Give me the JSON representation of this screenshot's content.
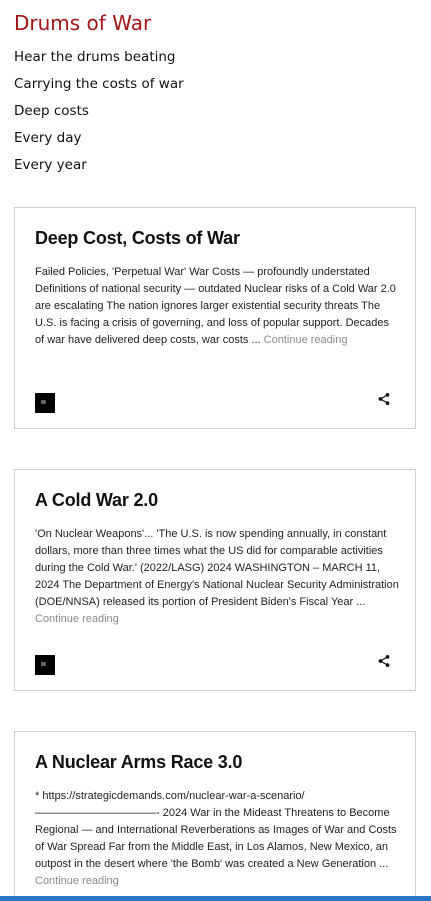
{
  "site": {
    "title": "Drums of War",
    "taglines": [
      "Hear the drums beating",
      "Carrying the costs of war",
      "Deep costs",
      "Every day",
      "Every year"
    ]
  },
  "posts": [
    {
      "title": "Deep Cost, Costs of War",
      "excerpt": "Failed Policies, 'Perpetual War'   War Costs — profoundly understated Definitions of national security — outdated Nuclear risks of a Cold War 2.0 are escalating The nation ignores larger existential security threats   The U.S. is facing a crisis of governing, and loss of popular support. Decades of war have delivered deep costs, war costs ...",
      "continue": "Continue reading"
    },
    {
      "title": "A Cold War 2.0",
      "excerpt": "    'On Nuclear Weapons'... 'The U.S. is now spending annually, in constant dollars, more than three times what the US did for comparable activities during the Cold War.' (2022/LASG)     2024 WASHINGTON – MARCH 11, 2024 The Department of Energy's National Nuclear Security Administration (DOE/NNSA) released its portion of President Biden's Fiscal Year ...",
      "continue": "Continue reading"
    },
    {
      "title": "A Nuclear Arms Race 3.0",
      "excerpt": "   * https://strategicdemands.com/nuclear-war-a-scenario/ ———————————-   2024   War in the Mideast Threatens to Become Regional — and International Reverberations as Images of War and Costs of War Spread       Far from the Middle East, in Los Alamos, New Mexico, an outpost in the desert where 'the Bomb' was created a New Generation ...",
      "continue": "Continue reading"
    }
  ],
  "colors": {
    "title": "#a31515",
    "continue": "#8a8a8a",
    "border": "#cfcfcf",
    "taskbar": "#2a76c6"
  }
}
